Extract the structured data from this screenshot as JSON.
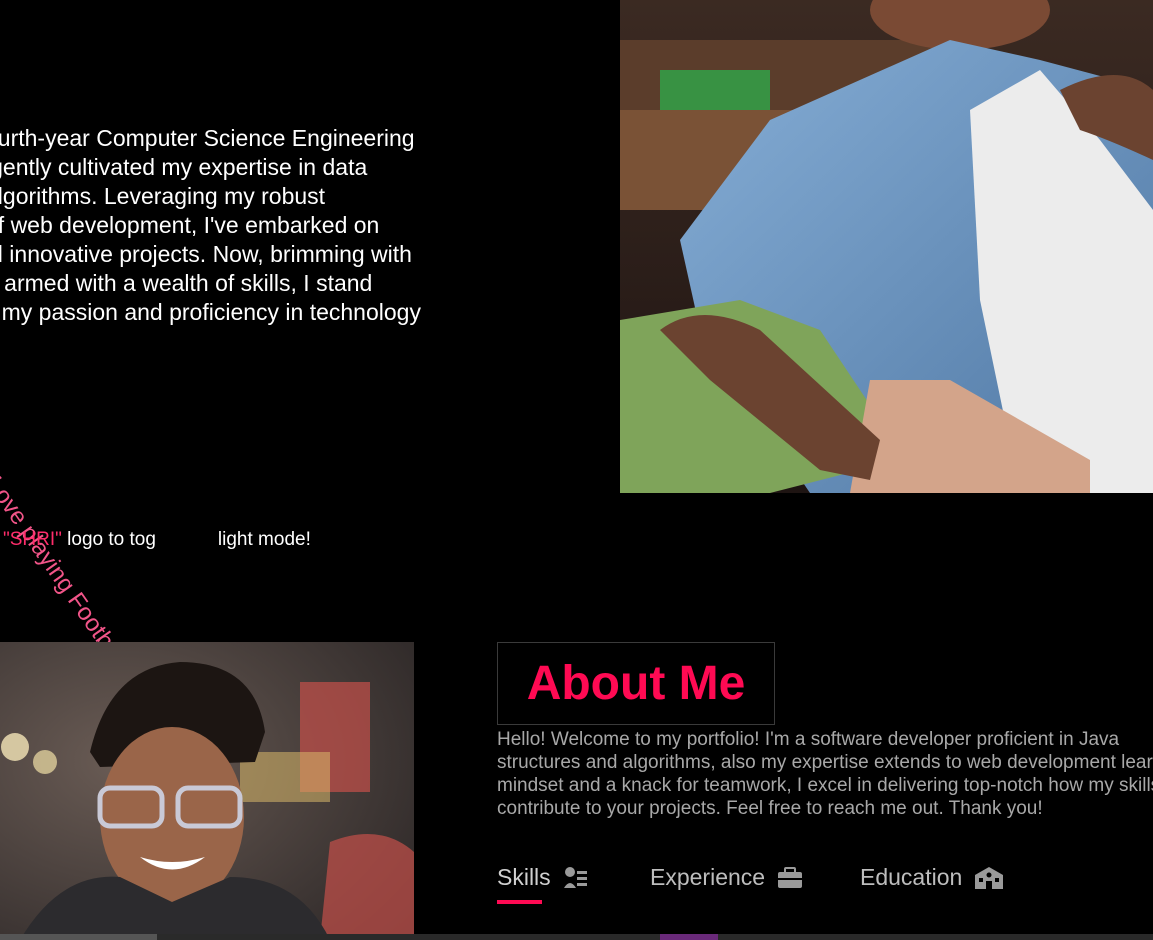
{
  "intro": {
    "paragraph": "ourth-year Computer Science Engineering\nigently cultivated my expertise in data\nalgorithms. Leveraging my robust\nof web development, I've embarked on\nal innovative projects. Now, brimming with\nd armed with a wealth of skills, I stand\nil my passion and proficiency in technology",
    "football_text": "I Love playing Football :)",
    "toggle_hint_logo": "\"SHRI\"",
    "toggle_hint_rest": " logo to tog",
    "toggle_hint_end": "light mode!"
  },
  "about": {
    "title": "About Me",
    "body": "Hello! Welcome to my portfolio! I'm a software developer proficient in Java structures and algorithms, also my expertise extends to web development learning mindset and a knack for teamwork, I excel in delivering top-notch how my skills can contribute to your projects. Feel free to reach me out. Thank you!"
  },
  "tabs": [
    {
      "label": "Skills",
      "icon": "skills-icon",
      "active": true
    },
    {
      "label": "Experience",
      "icon": "briefcase-icon",
      "active": false
    },
    {
      "label": "Education",
      "icon": "school-icon",
      "active": false
    }
  ],
  "colors": {
    "accent": "#ff0a53",
    "football": "#f25589",
    "muted_text": "#a8a8a8"
  }
}
